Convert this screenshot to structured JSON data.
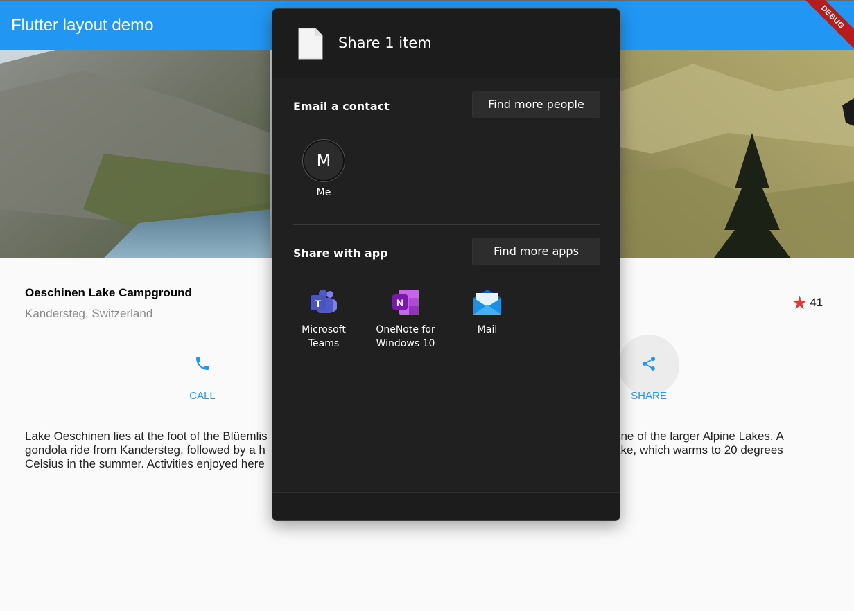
{
  "appbar": {
    "title": "Flutter layout demo",
    "debug_banner": "DEBUG"
  },
  "place": {
    "name": "Oeschinen Lake Campground",
    "location": "Kandersteg, Switzerland",
    "rating_count": "41"
  },
  "actions": [
    {
      "label": "CALL",
      "icon": "phone-icon"
    },
    {
      "label": "SHARE",
      "icon": "share-icon"
    }
  ],
  "description": {
    "line1_left": "Lake Oeschinen lies at the foot of the Blüemlis",
    "line1_right": "is one of the larger Alpine Lakes. A",
    "line2_left": "gondola ride from Kandersteg, followed by a h",
    "line2_right": "ake, which warms to 20 degrees",
    "line3_left": "Celsius in the summer. Activities enjoyed here"
  },
  "share_dialog": {
    "title": "Share 1 item",
    "email_section": {
      "title": "Email a contact",
      "more_button": "Find more people",
      "contacts": [
        {
          "initial": "M",
          "name": "Me"
        }
      ]
    },
    "apps_section": {
      "title": "Share with app",
      "more_button": "Find more apps",
      "apps": [
        {
          "name_line1": "Microsoft",
          "name_line2": "Teams",
          "icon": "teams-icon"
        },
        {
          "name_line1": "OneNote for",
          "name_line2": "Windows 10",
          "icon": "onenote-icon"
        },
        {
          "name_line1": "Mail",
          "name_line2": "",
          "icon": "mail-icon"
        }
      ]
    }
  },
  "colors": {
    "appbar": "#2196f3",
    "accent": "#2196f3",
    "star": "#e53935",
    "dialog_bg": "#202020"
  }
}
